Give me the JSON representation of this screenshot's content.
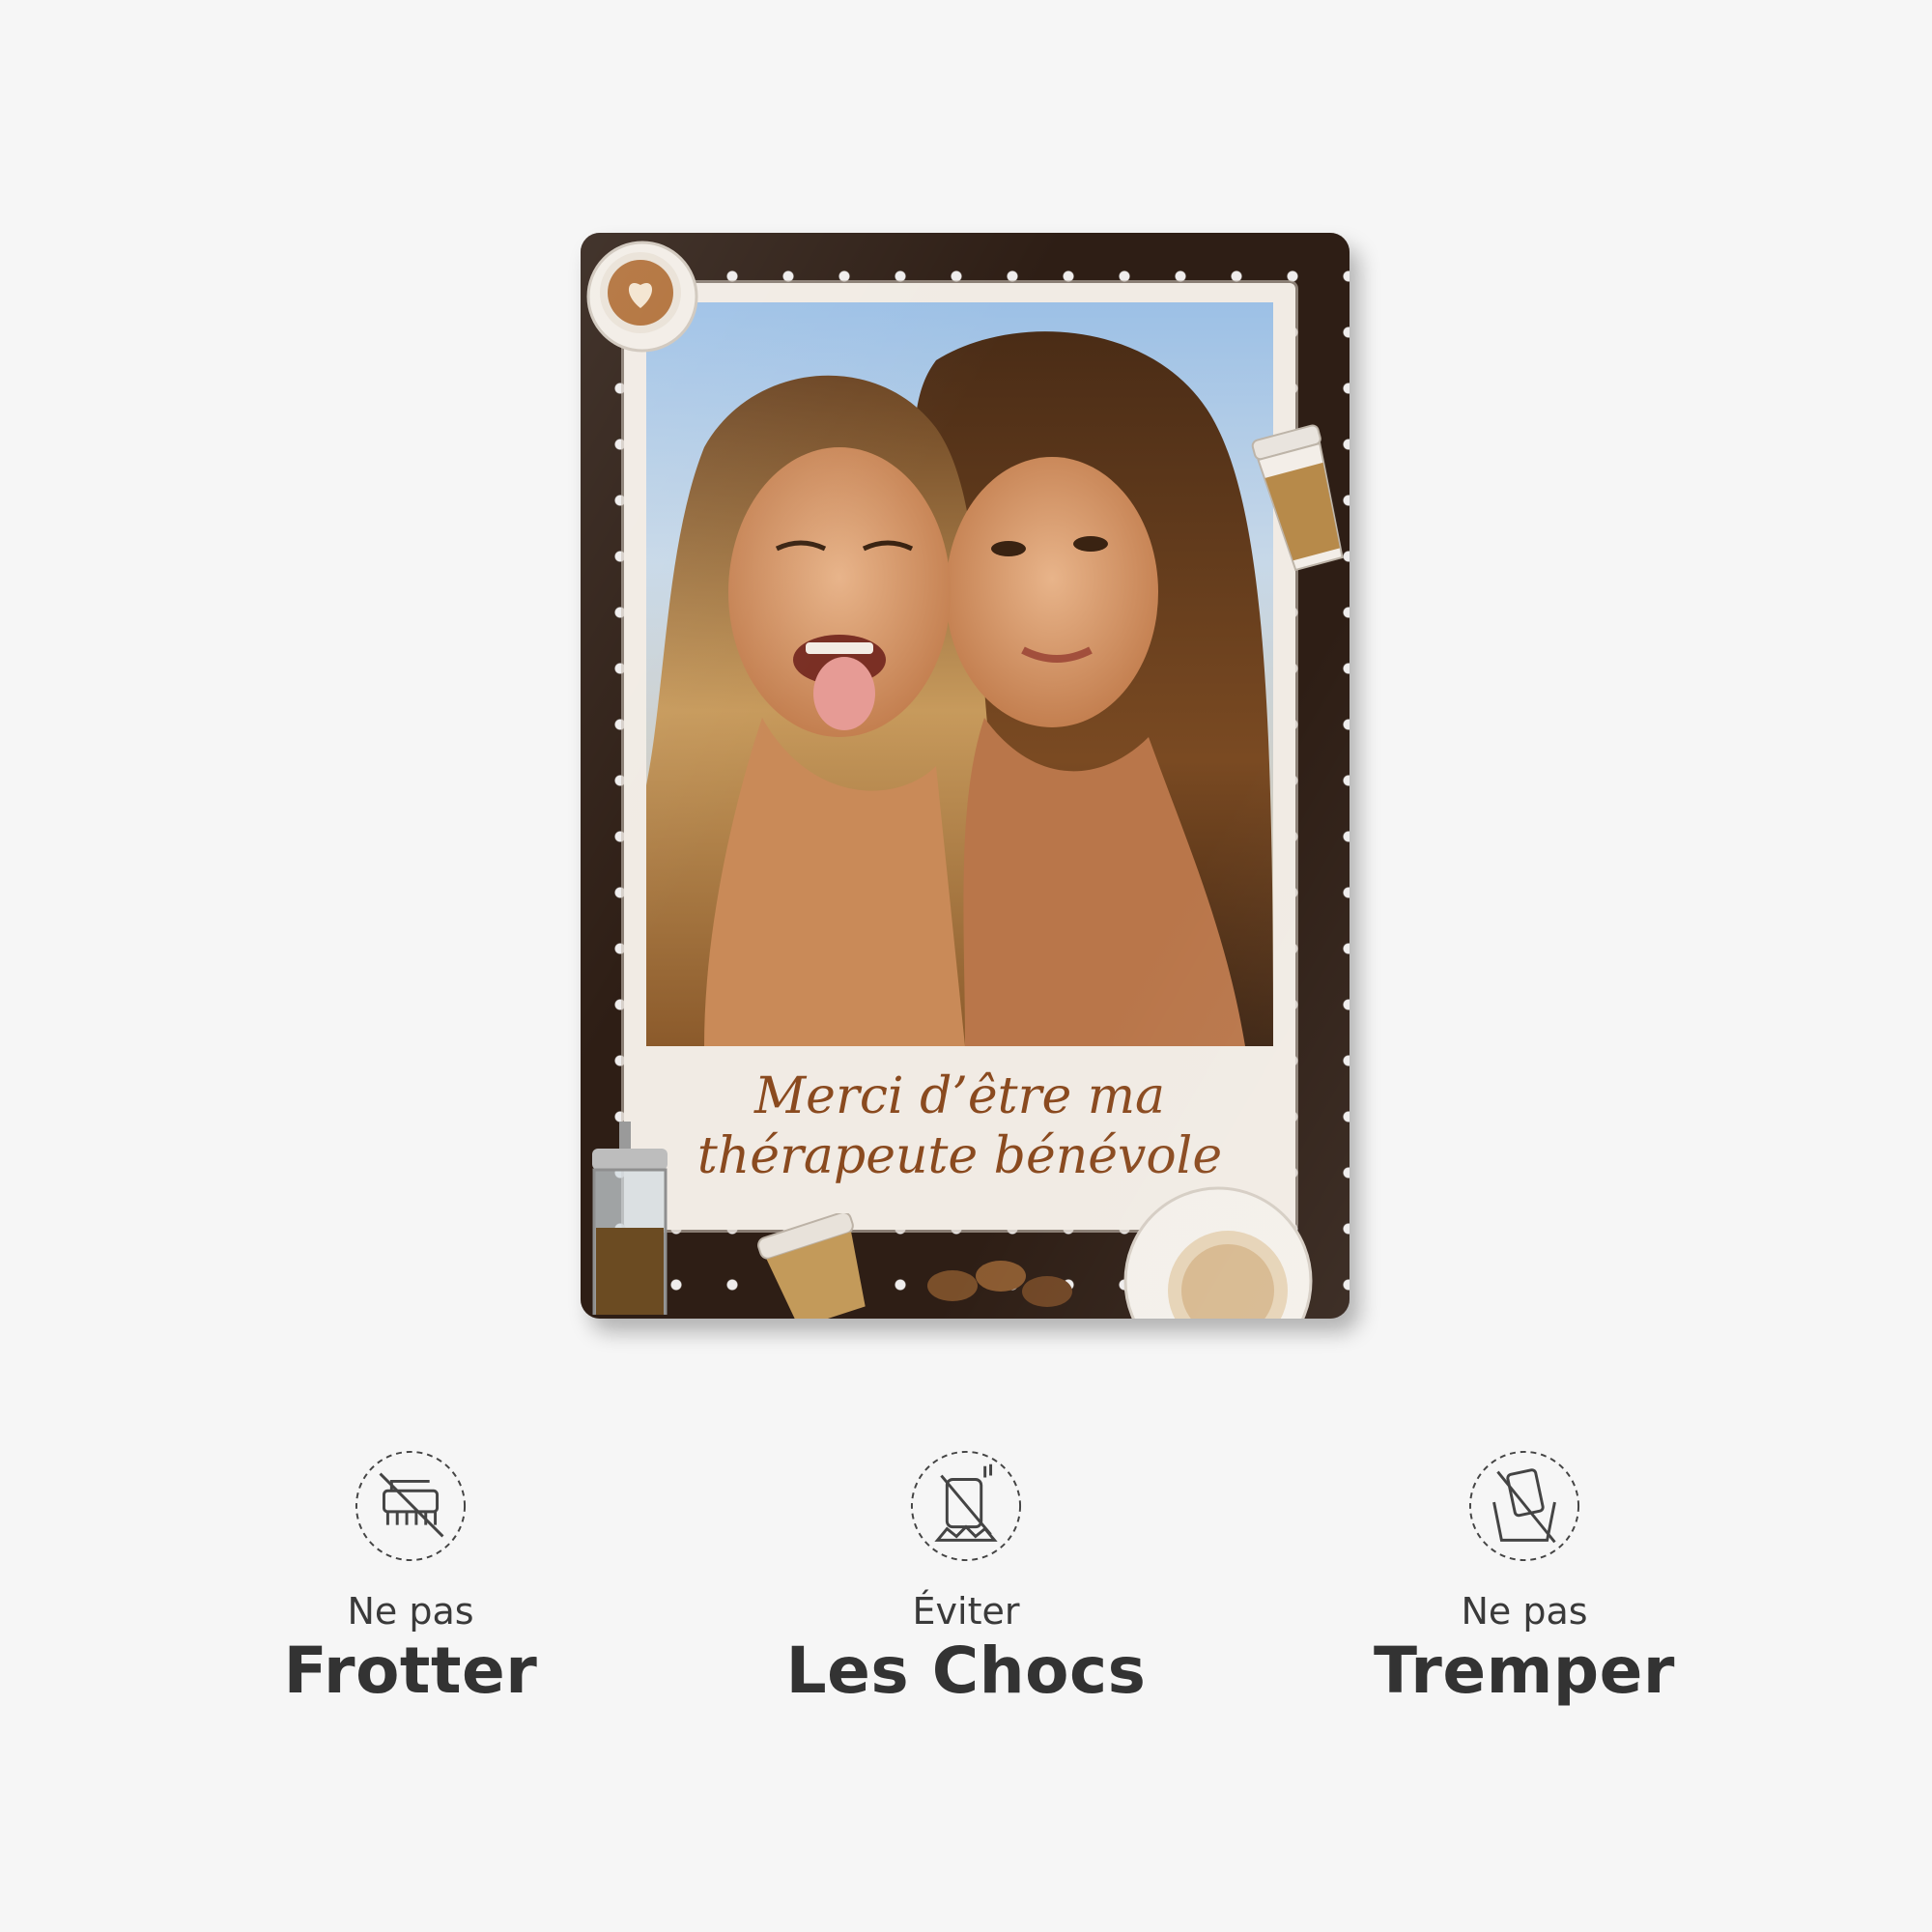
{
  "product": {
    "caption_line1": "Merci d’être ma",
    "caption_line2": "thérapeute bénévole"
  },
  "care": [
    {
      "small": "Ne pas",
      "big": "Frotter",
      "icon": "no-scrub-brush-icon"
    },
    {
      "small": "Éviter",
      "big": "Les Chocs",
      "icon": "no-impact-icon"
    },
    {
      "small": "Ne pas",
      "big": "Tremper",
      "icon": "no-soak-icon"
    }
  ],
  "colors": {
    "background": "#f6f6f6",
    "frame": "#2e1e15",
    "caption_text": "#8a4a1f",
    "care_text": "#333333"
  }
}
